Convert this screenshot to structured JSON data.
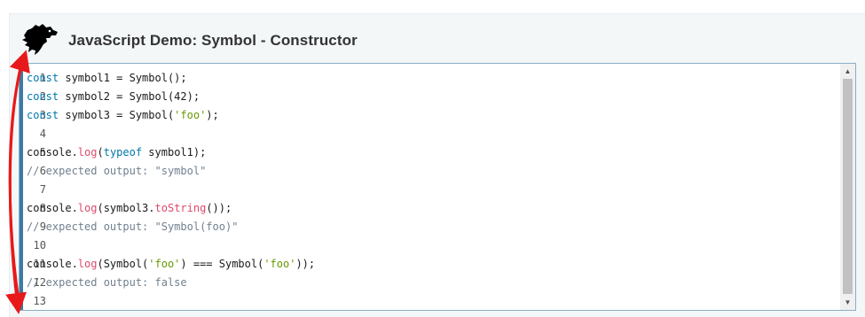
{
  "header": {
    "title": "JavaScript Demo: Symbol - Constructor",
    "logo_icon": "dinosaur-icon"
  },
  "editor": {
    "lines": [
      {
        "num": "1",
        "segments": [
          {
            "text": "const",
            "cls": "kw"
          },
          {
            "text": " symbol1 = Symbol();",
            "cls": ""
          }
        ]
      },
      {
        "num": "2",
        "segments": [
          {
            "text": "const",
            "cls": "kw"
          },
          {
            "text": " symbol2 = Symbol(42);",
            "cls": ""
          }
        ]
      },
      {
        "num": "3",
        "segments": [
          {
            "text": "const",
            "cls": "kw"
          },
          {
            "text": " symbol3 = Symbol(",
            "cls": ""
          },
          {
            "text": "'foo'",
            "cls": "str"
          },
          {
            "text": ");",
            "cls": ""
          }
        ]
      },
      {
        "num": "4",
        "segments": []
      },
      {
        "num": "5",
        "segments": [
          {
            "text": "console.",
            "cls": ""
          },
          {
            "text": "log",
            "cls": "fn"
          },
          {
            "text": "(",
            "cls": ""
          },
          {
            "text": "typeof",
            "cls": "kw"
          },
          {
            "text": " symbol1);",
            "cls": ""
          }
        ]
      },
      {
        "num": "6",
        "segments": [
          {
            "text": "// expected output: \"symbol\"",
            "cls": "cm"
          }
        ]
      },
      {
        "num": "7",
        "segments": []
      },
      {
        "num": "8",
        "segments": [
          {
            "text": "console.",
            "cls": ""
          },
          {
            "text": "log",
            "cls": "fn"
          },
          {
            "text": "(symbol3.",
            "cls": ""
          },
          {
            "text": "toString",
            "cls": "fn"
          },
          {
            "text": "());",
            "cls": ""
          }
        ]
      },
      {
        "num": "9",
        "segments": [
          {
            "text": "// expected output: \"Symbol(foo)\"",
            "cls": "cm"
          }
        ]
      },
      {
        "num": "10",
        "segments": []
      },
      {
        "num": "11",
        "segments": [
          {
            "text": "console.",
            "cls": ""
          },
          {
            "text": "log",
            "cls": "fn"
          },
          {
            "text": "(Symbol(",
            "cls": ""
          },
          {
            "text": "'foo'",
            "cls": "str"
          },
          {
            "text": ") === Symbol(",
            "cls": ""
          },
          {
            "text": "'foo'",
            "cls": "str"
          },
          {
            "text": "));",
            "cls": ""
          }
        ]
      },
      {
        "num": "12",
        "segments": [
          {
            "text": "// expected output: false",
            "cls": "cm"
          }
        ]
      },
      {
        "num": "13",
        "segments": []
      }
    ]
  },
  "scrollbar": {
    "up_icon": "scroll-up-arrow-icon",
    "down_icon": "scroll-down-arrow-icon"
  },
  "colors": {
    "accent": "#3e7aa4",
    "keyword": "#0077aa",
    "function": "#dd4a68",
    "string": "#669900",
    "comment": "#708090",
    "annotation_arrow": "#e8191a"
  }
}
